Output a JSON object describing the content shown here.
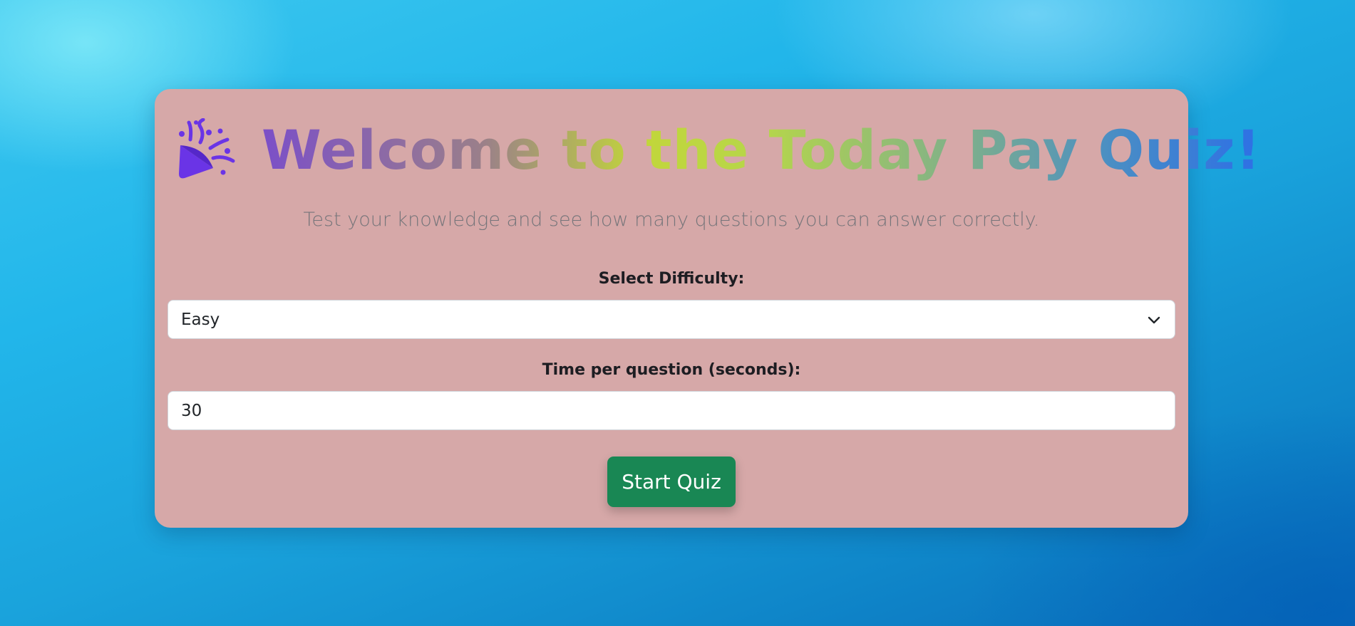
{
  "colors": {
    "card_background": "#d6a8a8",
    "button_primary": "#198754",
    "icon_purple": "#6a34e6"
  },
  "header": {
    "icon": "party-popper-icon",
    "title": "Welcome to the Today Pay Quiz!",
    "subtitle": "Test your knowledge and see how many questions you can answer correctly."
  },
  "form": {
    "difficulty_label": "Select Difficulty:",
    "difficulty_value": "Easy",
    "time_label": "Time per question (seconds):",
    "time_value": "30"
  },
  "actions": {
    "start_label": "Start Quiz"
  }
}
